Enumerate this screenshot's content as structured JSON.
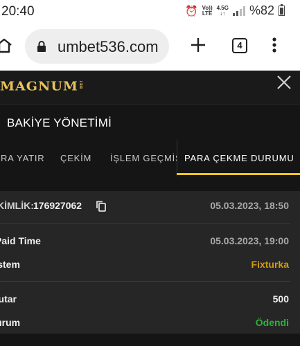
{
  "status_bar": {
    "time": "20:40",
    "volte": "Vo))",
    "lte": "LTE",
    "network": "4.5G",
    "battery": "%82"
  },
  "browser": {
    "url": "umbet536.com",
    "tab_count": "4"
  },
  "header": {
    "logo_main": "MAGNUM",
    "logo_sub": "BET"
  },
  "page": {
    "title": "BAKİYE YÖNETİMİ"
  },
  "tabs": [
    {
      "label": "PARA YATIR"
    },
    {
      "label": "ÇEKİM"
    },
    {
      "label": "İŞLEM GEÇMİŞİ"
    },
    {
      "label": "PARA ÇEKME DURUMU",
      "active": true
    }
  ],
  "withdrawal": {
    "id_label": "KİMLİK:",
    "id_value": "176927062",
    "created": "05.03.2023, 18:50",
    "paid_time_label": "Paid Time",
    "paid_time": "05.03.2023, 19:00",
    "system_label": "Sistem",
    "system_value": "Fixturka",
    "amount_label": "Tutar",
    "amount_value": "500",
    "status_label": "Durum",
    "status_value": "Ödendi"
  },
  "colors": {
    "accent": "#f5c518",
    "system": "#d39a12",
    "paid": "#2cb23c"
  }
}
